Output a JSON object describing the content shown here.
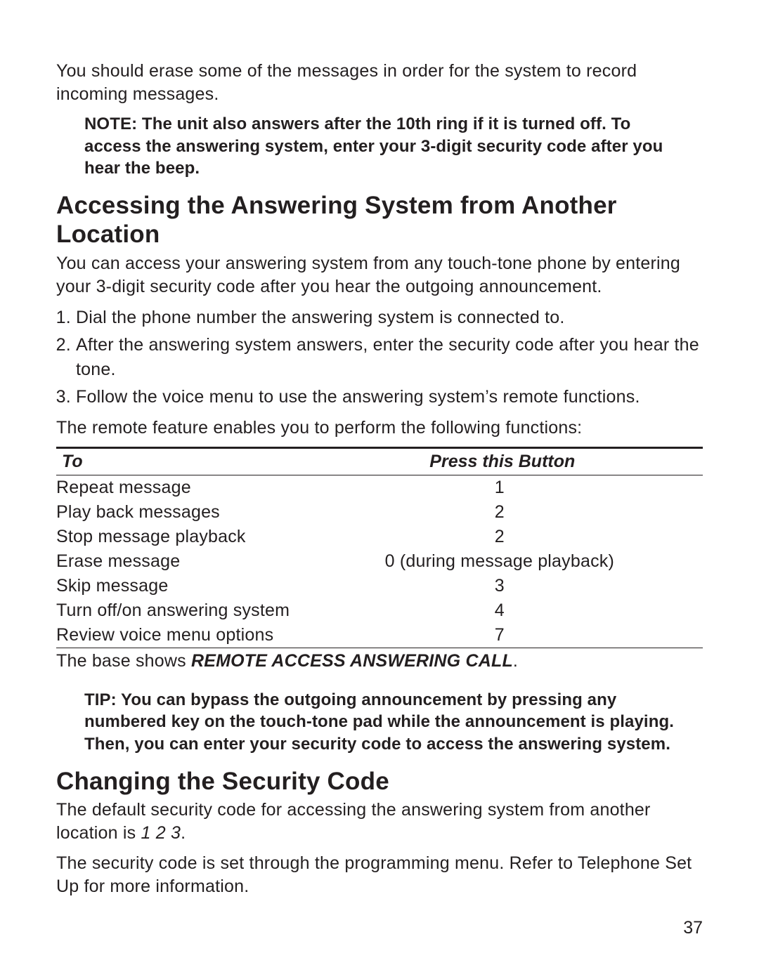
{
  "intro_paragraph": "You should erase some of the messages in order for the system to record incoming messages.",
  "note_block": "NOTE: The unit also answers after the 10th ring if it is turned off. To access the answering system, enter your 3-digit security code after you hear the beep.",
  "section1": {
    "heading": "Accessing the Answering System from Another Location",
    "intro": "You can access your answering system from any touch-tone phone by entering your 3-digit security code after you hear the outgoing announcement.",
    "steps": [
      "Dial the phone number the answering system is connected to.",
      "After the answering system answers, enter the security code after you hear the tone.",
      "Follow the voice menu to use the answering system’s remote functions."
    ],
    "after_steps": "The remote feature enables you to perform the following functions:",
    "table": {
      "headers": {
        "left": "To",
        "right": "Press this Button"
      },
      "rows": [
        {
          "to": "Repeat message",
          "button": "1"
        },
        {
          "to": "Play back messages",
          "button": "2"
        },
        {
          "to": "Stop message playback",
          "button": "2"
        },
        {
          "to": "Erase message",
          "button": "0 (during message playback)"
        },
        {
          "to": "Skip message",
          "button": "3"
        },
        {
          "to": "Turn off/on answering system",
          "button": "4"
        },
        {
          "to": "Review voice menu options",
          "button": "7"
        }
      ]
    },
    "after_table_prefix": "The base shows ",
    "after_table_emph": "REMOTE ACCESS ANSWERING CALL",
    "after_table_suffix": ".",
    "tip_block": "TIP: You can bypass the outgoing announcement by pressing any numbered key on the touch-tone pad while the announcement is playing. Then, you can enter your security code to access the answering system."
  },
  "section2": {
    "heading": "Changing the Security Code",
    "p1_prefix": "The default security code for accessing the answering system from another location is  ",
    "p1_code": "1 2 3",
    "p1_suffix": ".",
    "p2": "The security code is set through the programming menu. Refer to Telephone Set Up for more information."
  },
  "page_number": "37"
}
